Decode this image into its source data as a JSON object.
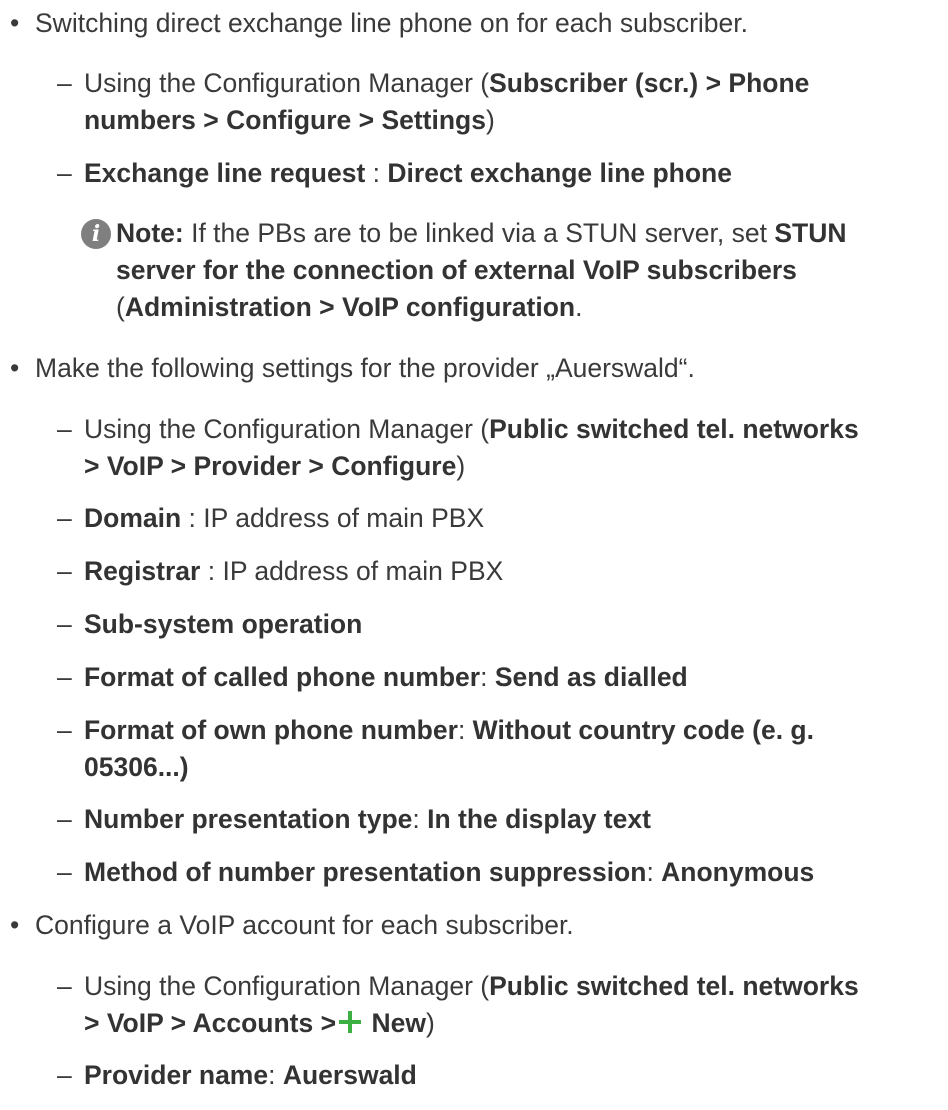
{
  "section1": {
    "bullet": "•",
    "text": "Switching direct exchange line phone on for each subscriber.",
    "sub1": {
      "dash": "–",
      "prefix": "Using the Configuration Manager (",
      "path_l1": "Subscriber (scr.) > Phone",
      "path_l2": "numbers > Configure > Settings",
      "suffix": ")"
    },
    "sub2": {
      "dash": "–",
      "label": "Exchange line request",
      "sep": " : ",
      "value": "Direct exchange line phone"
    },
    "note": {
      "icon": "info-icon",
      "icon_glyph": "i",
      "label": "Note:",
      "text1": " If the PBs are to be linked via a STUN server, set ",
      "bold1": "STUN",
      "bold2": "server for the connection of external VoIP subscribers",
      "open_paren": "(",
      "bold3": "Administration > VoIP configuration",
      "end": "."
    }
  },
  "section2": {
    "bullet": "•",
    "text": "Make the following settings for the provider „Auerswald“.",
    "items": [
      {
        "dash": "–",
        "prefix": "Using the Configuration Manager (",
        "path_l1": "Public switched tel. networks",
        "path_l2": "> VoIP > Provider > Configure",
        "suffix": ")"
      },
      {
        "dash": "–",
        "label": "Domain",
        "sep": " : ",
        "value": "IP address of main PBX"
      },
      {
        "dash": "–",
        "label": "Registrar",
        "sep": " : ",
        "value": "IP address of main PBX"
      },
      {
        "dash": "–",
        "label": "Sub-system operation"
      },
      {
        "dash": "–",
        "label": "Format of called phone number",
        "sep": ": ",
        "value": "Send as dialled"
      },
      {
        "dash": "–",
        "label": "Format of own phone number",
        "sep": ": ",
        "value_l1": "Without country code (e. g.",
        "value_l2": "05306...)"
      },
      {
        "dash": "–",
        "label": "Number presentation type",
        "sep": ": ",
        "value": "In the display text"
      },
      {
        "dash": "–",
        "label": "Method of number presentation suppression",
        "sep": ": ",
        "value": "Anonymous"
      }
    ]
  },
  "section3": {
    "bullet": "•",
    "text": "Configure a VoIP account for each subscriber.",
    "items": [
      {
        "dash": "–",
        "prefix": "Using the Configuration Manager (",
        "path_l1": "Public switched tel. networks",
        "path_l2a": "> VoIP > Accounts >",
        "icon": "plus-icon",
        "path_l2b": " New",
        "suffix": ")"
      },
      {
        "dash": "–",
        "label": "Provider name",
        "sep": ": ",
        "value": "Auerswald"
      }
    ]
  },
  "colors": {
    "text": "#3a3a3a",
    "bold": "#333333",
    "info_icon": "#7f7f7f",
    "plus_icon": "#3cb043"
  }
}
